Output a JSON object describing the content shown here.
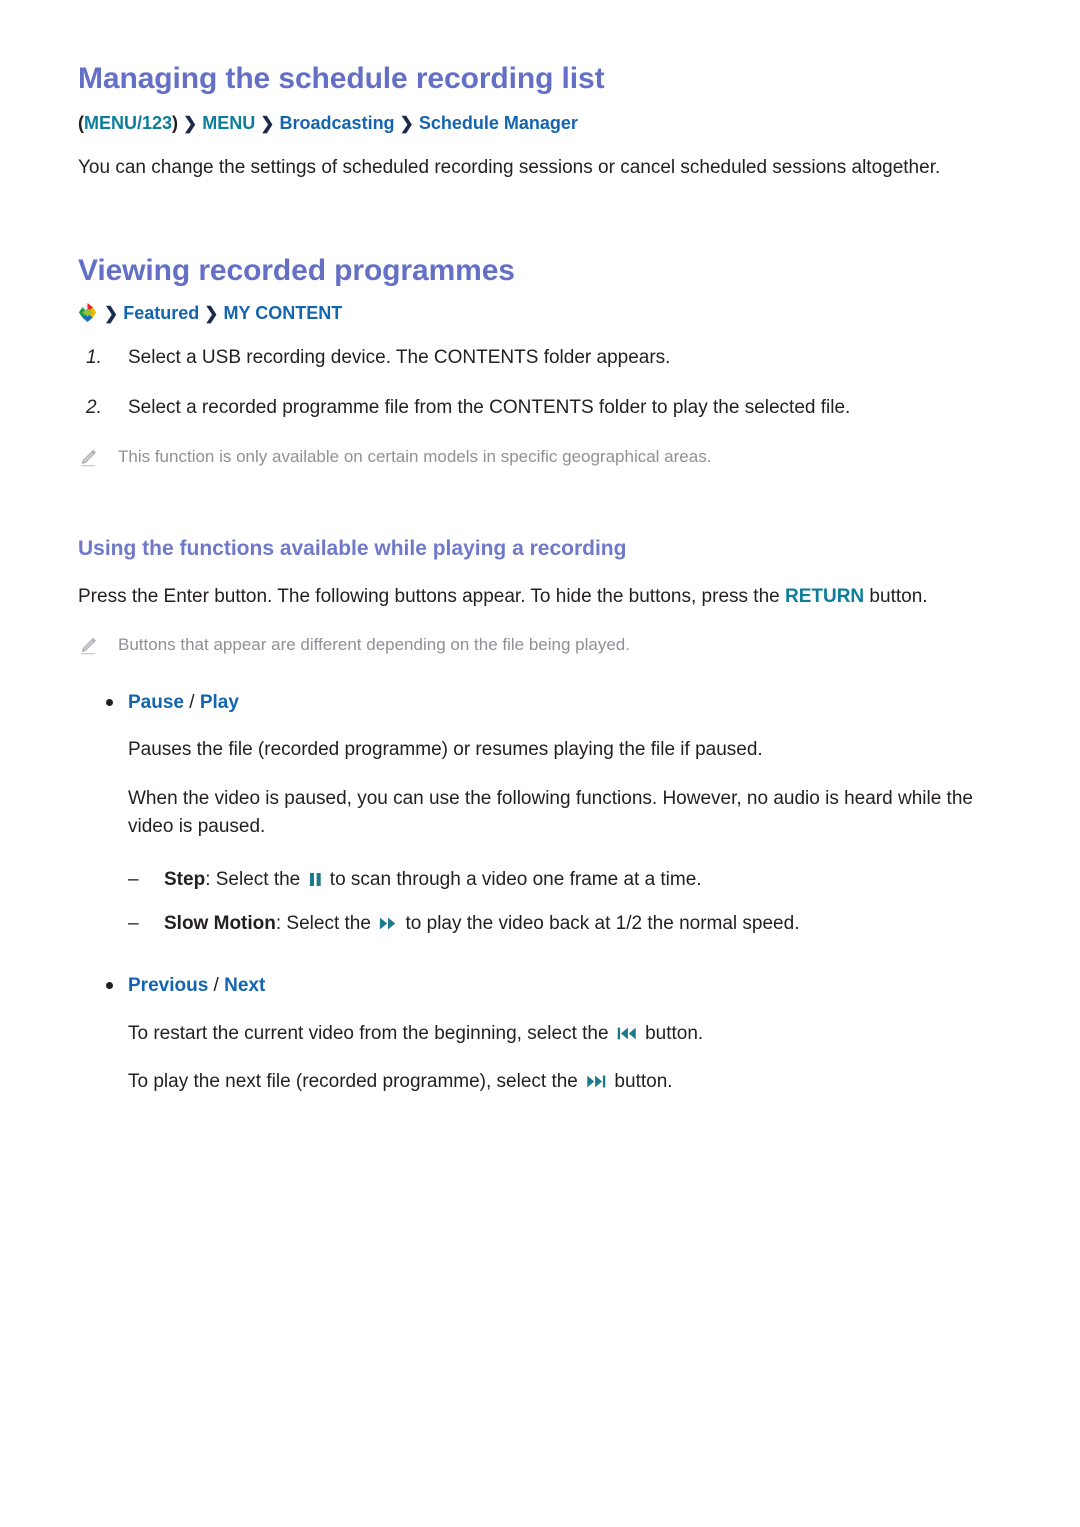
{
  "colors": {
    "heading": "#6470c6",
    "subheading": "#7079c9",
    "teal": "#0d7d99",
    "blue": "#1465b0",
    "body": "#231f20",
    "note": "#8d9196",
    "media_icon": "#1b7a8c"
  },
  "section1": {
    "title": "Managing the schedule recording list",
    "breadcrumb": {
      "open_paren": "(",
      "item1": "MENU/123",
      "close_paren": ")",
      "arrow": "❯",
      "item2": "MENU",
      "item3": "Broadcasting",
      "item4": "Schedule Manager"
    },
    "paragraph": "You can change the settings of scheduled recording sessions or cancel scheduled sessions altogether."
  },
  "section2": {
    "title": "Viewing recorded programmes",
    "breadcrumb": {
      "icon": "smart-hub-icon",
      "arrow": "❯",
      "item1": "Featured",
      "item2": "MY CONTENT"
    },
    "steps": [
      {
        "num": "1.",
        "text": "Select a USB recording device. The CONTENTS folder appears."
      },
      {
        "num": "2.",
        "text": "Select a recorded programme file from the CONTENTS folder to play the selected file."
      }
    ],
    "note": {
      "icon": "pencil-icon",
      "text": "This function is only available on certain models in specific geographical areas."
    }
  },
  "section3": {
    "title": "Using the functions available while playing a recording",
    "intro_before": "Press the Enter button. The following buttons appear. To hide the buttons, press the ",
    "intro_key": "RETURN",
    "intro_after": " button.",
    "note": {
      "icon": "pencil-icon",
      "text": "Buttons that appear are different depending on the file being played."
    },
    "bullets": [
      {
        "label_a": "Pause",
        "separator": " / ",
        "label_b": "Play",
        "paragraphs": [
          "Pauses the file (recorded programme) or resumes playing the file if paused.",
          "When the video is paused, you can use the following functions. However, no audio is heard while the video is paused."
        ],
        "sub_items": [
          {
            "dash": "–",
            "term": "Step",
            "text_before": ": Select the ",
            "icon": "pause-icon",
            "text_after": " to scan through a video one frame at a time."
          },
          {
            "dash": "–",
            "term": "Slow Motion",
            "text_before": ": Select the ",
            "icon": "fast-forward-icon",
            "text_after": " to play the video back at 1/2 the normal speed."
          }
        ]
      },
      {
        "label_a": "Previous",
        "separator": " / ",
        "label_b": "Next",
        "lines": [
          {
            "text_before": "To restart the current video from the beginning, select the ",
            "icon": "skip-previous-icon",
            "text_after": " button."
          },
          {
            "text_before": "To play the next file (recorded programme), select the ",
            "icon": "skip-next-icon",
            "text_after": " button."
          }
        ]
      }
    ]
  }
}
